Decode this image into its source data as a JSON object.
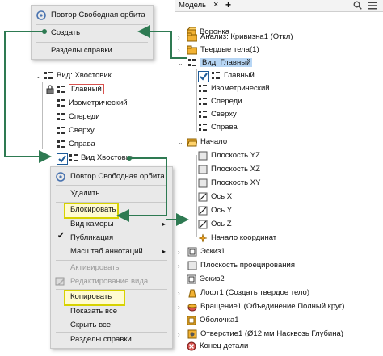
{
  "top_menu": {
    "items": [
      "Повтор Свободная орбита",
      "Создать",
      "Разделы справки..."
    ]
  },
  "left_tree": {
    "root": "Вид: Хвостовик",
    "children": [
      "Главный",
      "Изометрический",
      "Спереди",
      "Сверху",
      "Справа",
      "Вид Хвостовик"
    ]
  },
  "context_menu": {
    "items": [
      {
        "label": "Повтор Свободная орбита",
        "enabled": true
      },
      {
        "label": "Удалить",
        "enabled": true
      },
      {
        "label": "Блокировать",
        "enabled": true,
        "highlighted": true
      },
      {
        "label": "Вид камеры",
        "enabled": true,
        "submenu": true
      },
      {
        "label": "Публикация",
        "enabled": true,
        "checked": true
      },
      {
        "label": "Масштаб аннотаций",
        "enabled": true,
        "submenu": true
      },
      {
        "label": "Активировать",
        "enabled": false
      },
      {
        "label": "Редактирование вида",
        "enabled": false
      },
      {
        "label": "Копировать",
        "enabled": true,
        "highlighted": true
      },
      {
        "label": "Показать все",
        "enabled": true
      },
      {
        "label": "Скрыть все",
        "enabled": true
      },
      {
        "label": "Разделы справки...",
        "enabled": true
      }
    ]
  },
  "browser": {
    "tab_label": "Модель",
    "close_glyph": "×",
    "add_glyph": "+",
    "icons": [
      "search-icon",
      "menu-icon"
    ],
    "tree": [
      {
        "label": "Воронка",
        "level": 0
      },
      {
        "label": "Анализ: Кривизна1 (Откл)",
        "level": 1
      },
      {
        "label": "Твердые тела(1)",
        "level": 1
      },
      {
        "label": "Вид: Главный",
        "level": 1,
        "selected": true
      },
      {
        "label": "Главный",
        "level": 2
      },
      {
        "label": "Изометрический",
        "level": 2
      },
      {
        "label": "Спереди",
        "level": 2
      },
      {
        "label": "Сверху",
        "level": 2
      },
      {
        "label": "Справа",
        "level": 2
      },
      {
        "label": "Начало",
        "level": 1
      },
      {
        "label": "Плоскость YZ",
        "level": 2
      },
      {
        "label": "Плоскость XZ",
        "level": 2
      },
      {
        "label": "Плоскость XY",
        "level": 2
      },
      {
        "label": "Ось X",
        "level": 2
      },
      {
        "label": "Ось Y",
        "level": 2
      },
      {
        "label": "Ось Z",
        "level": 2
      },
      {
        "label": "Начало координат",
        "level": 2
      },
      {
        "label": "Эскиз1",
        "level": 1
      },
      {
        "label": "Плоскость проецирования",
        "level": 1
      },
      {
        "label": "Эскиз2",
        "level": 1
      },
      {
        "label": "Лофт1 (Создать твердое тело)",
        "level": 1
      },
      {
        "label": "Вращение1 (Объединение Полный круг)",
        "level": 1
      },
      {
        "label": "Оболочка1",
        "level": 1
      },
      {
        "label": "Отверстие1 (Ø12 мм Насквозь Глубина)",
        "level": 1
      },
      {
        "label": "Конец детали",
        "level": 1
      }
    ]
  },
  "colors": {
    "arrow": "#2e7a52",
    "highlight_border": "#d7d200",
    "selection": "#b7d6f5"
  }
}
